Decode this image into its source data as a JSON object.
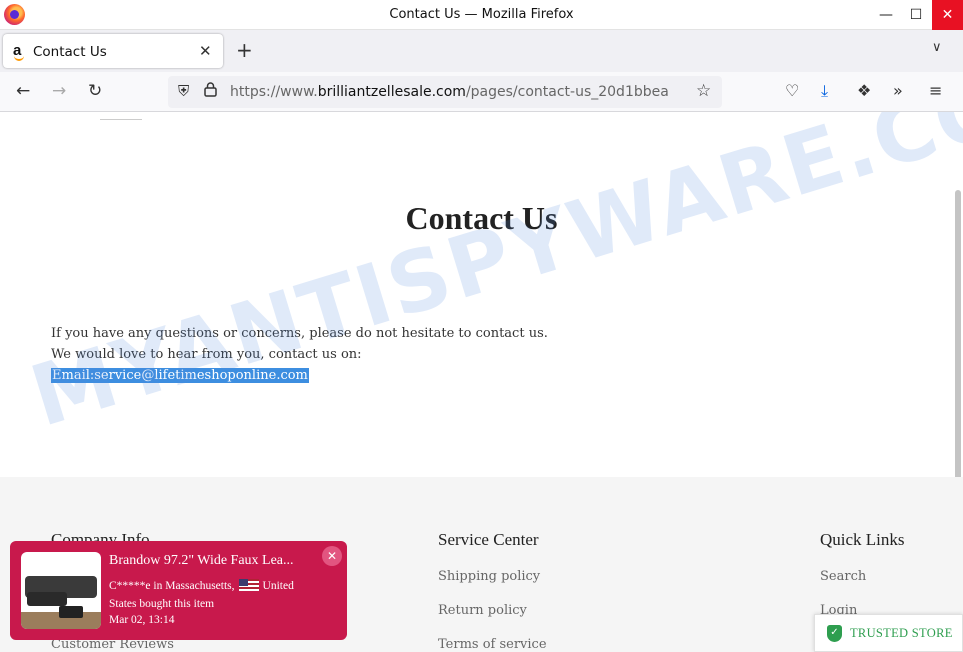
{
  "window": {
    "title": "Contact Us — Mozilla Firefox",
    "minimize_icon": "—",
    "maximize_icon": "☐",
    "close_icon": "✕"
  },
  "tabs": [
    {
      "label": "Contact Us",
      "favicon": "a"
    }
  ],
  "tab_icons": {
    "close": "✕",
    "new": "+",
    "list": "∨"
  },
  "nav": {
    "back": "←",
    "forward": "→",
    "reload": "↻",
    "url_prefix": "https://www.",
    "url_domain": "brilliantzellesale.com",
    "url_path": "/pages/contact-us_20d1bbea",
    "shield": "⛨",
    "lock": "🔒",
    "star": "☆",
    "pocket": "♡",
    "download": "⤓",
    "extensions": "❖",
    "more": "»",
    "menu": "≡"
  },
  "page": {
    "title": "Contact Us",
    "line1": "If you have any questions or concerns, please do not hesitate to contact us.",
    "line2": "We would love to hear from you, contact us on:",
    "email": "Email:service@lifetimeshoponline.com"
  },
  "watermark": "MYANTISPYWARE.COM",
  "footer": {
    "columns": [
      {
        "heading": "Company Info",
        "links": [
          "Customer Reviews"
        ]
      },
      {
        "heading": "Service Center",
        "links": [
          "Shipping policy",
          "Return policy",
          "Terms of service"
        ]
      },
      {
        "heading": "Quick Links",
        "links": [
          "Search",
          "Login"
        ]
      }
    ]
  },
  "popup": {
    "title": "Brandow 97.2\" Wide Faux Lea...",
    "line1": "C*****e in Massachusetts,",
    "country": "United",
    "line2": "States bought this item",
    "date": "Mar 02, 13:14",
    "close": "✕"
  },
  "trusted": {
    "label": "TRUSTED STORE",
    "icon": "✓"
  },
  "colors": {
    "popup_bg": "#c8194c",
    "trusted_green": "#2e9e4f",
    "email_highlight": "#3d8ee0"
  }
}
